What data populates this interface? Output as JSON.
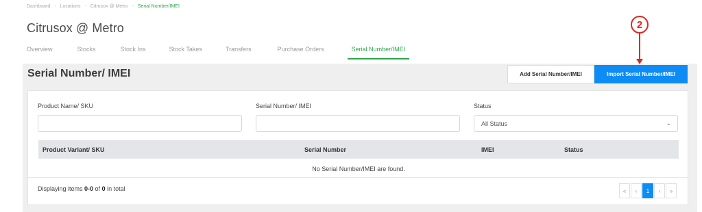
{
  "breadcrumb": [
    "Dashboard",
    "Locations",
    "Citrusox @ Metro",
    "Serial Number/IMEI"
  ],
  "location_title": "Citrusox @ Metro",
  "tabs": [
    {
      "label": "Overview",
      "active": false
    },
    {
      "label": "Stocks",
      "active": false
    },
    {
      "label": "Stock Ins",
      "active": false
    },
    {
      "label": "Stock Takes",
      "active": false
    },
    {
      "label": "Transfers",
      "active": false
    },
    {
      "label": "Purchase Orders",
      "active": false
    },
    {
      "label": "Serial Number/IMEI",
      "active": true
    }
  ],
  "page_title": "Serial Number/ IMEI",
  "buttons": {
    "add": "Add Serial Number/IMEI",
    "import": "Import Serial Number/IMEI"
  },
  "annotation": {
    "number": "2",
    "color": "#e0281e"
  },
  "filters": {
    "product_label": "Product Name/ SKU",
    "product_value": "",
    "serial_label": "Serial Number/ IMEI",
    "serial_value": "",
    "status_label": "Status",
    "status_selected": "All Status"
  },
  "table": {
    "columns": [
      "Product Variant/ SKU",
      "Serial Number",
      "IMEI",
      "Status"
    ],
    "rows": [],
    "empty_message": "No Serial Number/IMEI are found."
  },
  "footer": {
    "prefix": "Displaying items ",
    "range": "0-0",
    "of": " of ",
    "total": "0",
    "suffix": " in total"
  },
  "pagination": {
    "first": "«",
    "prev": "‹",
    "current": "1",
    "next": "›",
    "last": "»"
  },
  "colors": {
    "accent": "#28a745",
    "primary": "#0d8cf5"
  }
}
